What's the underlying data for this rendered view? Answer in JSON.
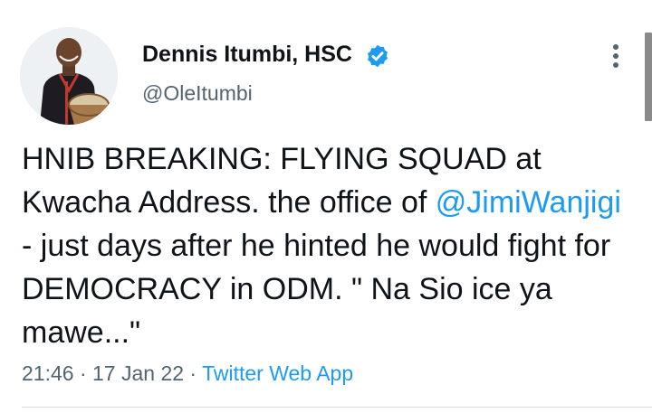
{
  "author": {
    "name": "Dennis Itumbi, HSC",
    "handle": "@OleItumbi",
    "verified": true,
    "avatar_icon": "person-with-drum-avatar"
  },
  "tweet": {
    "text_1": "HNIB BREAKING: FLYING SQUAD at Kwacha Address. the office of ",
    "mention": "@JimiWanjigi",
    "text_2": " - just days after he hinted he would fight for DEMOCRACY in ODM. \" Na Sio ice ya mawe...\""
  },
  "meta": {
    "time": "21:46",
    "sep1": " · ",
    "date": "17 Jan 22",
    "sep2": " · ",
    "source": "Twitter Web App"
  },
  "colors": {
    "accent": "#1d9bf0",
    "secondary_text": "#536471",
    "primary_text": "#0f1419"
  }
}
